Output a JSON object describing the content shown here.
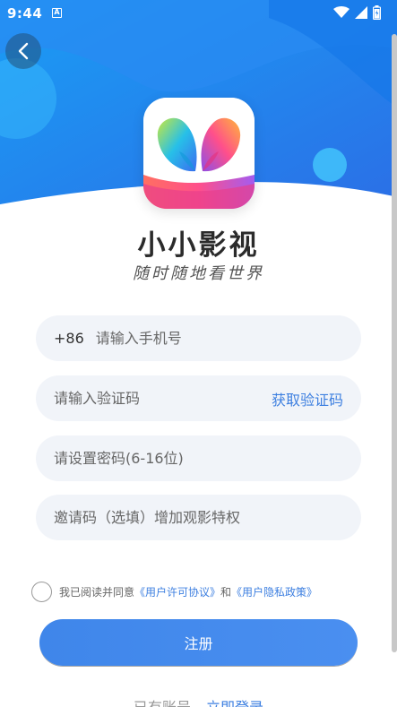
{
  "status_bar": {
    "time": "9:44",
    "notification_icon": "A"
  },
  "header": {
    "back_icon": "chevron-left-icon"
  },
  "app": {
    "name": "小小影视",
    "slogan": "随时随地看世界",
    "logo_icon": "butterfly-logo-icon"
  },
  "form": {
    "phone": {
      "prefix": "+86",
      "placeholder": "请输入手机号",
      "value": ""
    },
    "code": {
      "placeholder": "请输入验证码",
      "value": "",
      "action_label": "获取验证码"
    },
    "password": {
      "placeholder": "请设置密码(6-16位)",
      "value": ""
    },
    "invite": {
      "placeholder": "邀请码（选填）增加观影特权",
      "value": ""
    }
  },
  "agreement": {
    "checked": false,
    "prefix": "我已阅读并同意",
    "user_license": "《用户许可协议》",
    "and": "和",
    "privacy_policy": "《用户隐私政策》"
  },
  "register_button": {
    "label": "注册"
  },
  "login": {
    "prompt": "已有账号",
    "link_label": "立即登录"
  },
  "colors": {
    "accent": "#3d7fe0",
    "header_blue": "#1e8cf0",
    "field_bg": "#f1f4f9"
  }
}
